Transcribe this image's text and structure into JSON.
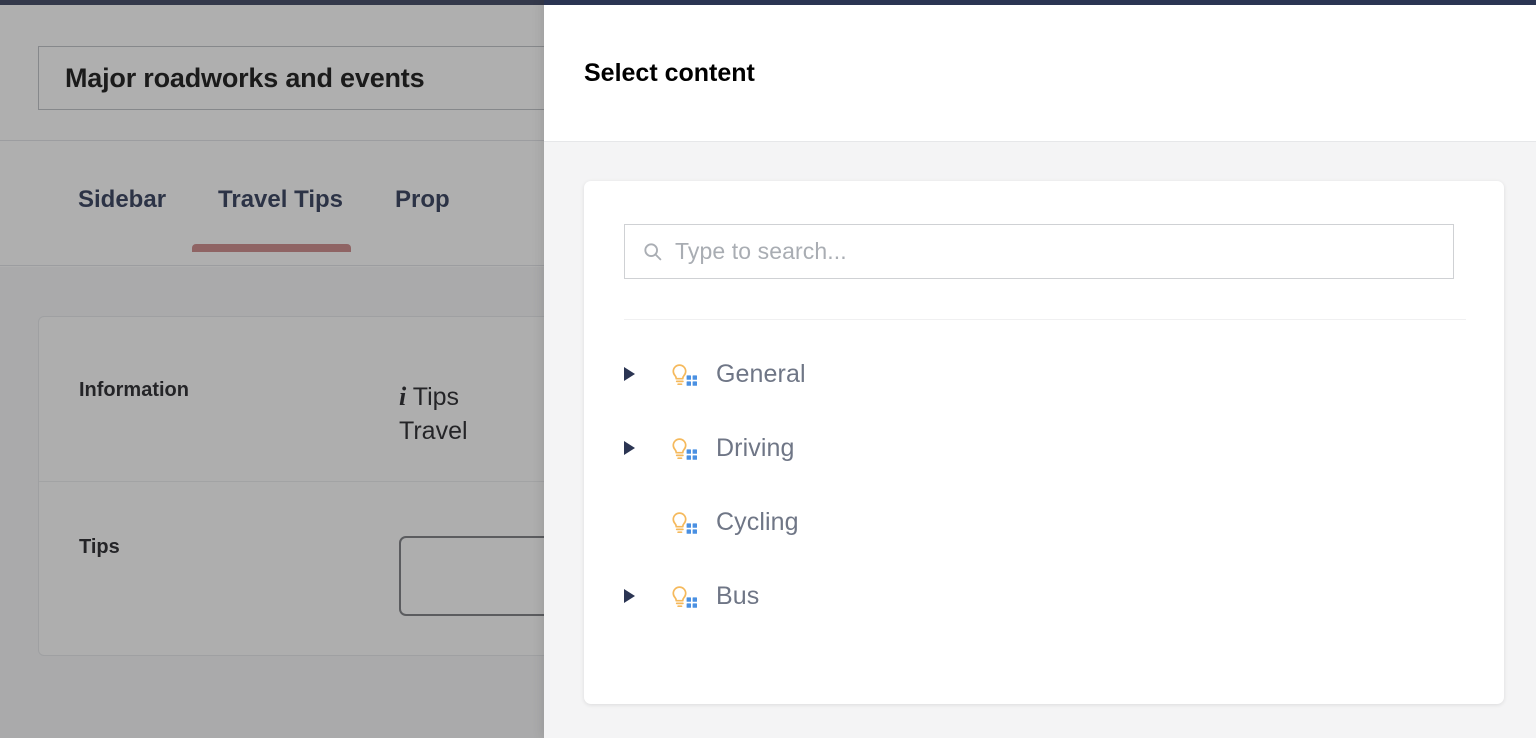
{
  "theme": {
    "topbar_color": "#2b3553",
    "active_tab_underline": "#c97e7e",
    "bulb_color": "#f5b95c",
    "grid_dot_color": "#4a90e2",
    "tree_label_color": "#6f7686",
    "overlay_color": "#404040"
  },
  "background_app": {
    "title_field": {
      "value": "Major roadworks and events"
    },
    "tabs": [
      {
        "label": "Sidebar",
        "active": false
      },
      {
        "label": "Travel Tips",
        "active": true
      },
      {
        "label": "Prop",
        "active": false
      }
    ],
    "panel": {
      "rows": [
        {
          "label": "Information",
          "icon": "info-italic-icon",
          "value_line1": "Tips",
          "value_line2": "Travel"
        },
        {
          "label": "Tips",
          "value": ""
        }
      ]
    }
  },
  "drawer": {
    "title": "Select content",
    "search": {
      "placeholder": "Type to search...",
      "value": "",
      "icon": "search-icon"
    },
    "tree_items": [
      {
        "label": "General",
        "expandable": true,
        "icon": "lightbulb-grid-icon"
      },
      {
        "label": "Driving",
        "expandable": true,
        "icon": "lightbulb-grid-icon"
      },
      {
        "label": "Cycling",
        "expandable": false,
        "icon": "lightbulb-grid-icon"
      },
      {
        "label": "Bus",
        "expandable": true,
        "icon": "lightbulb-grid-icon"
      }
    ]
  }
}
